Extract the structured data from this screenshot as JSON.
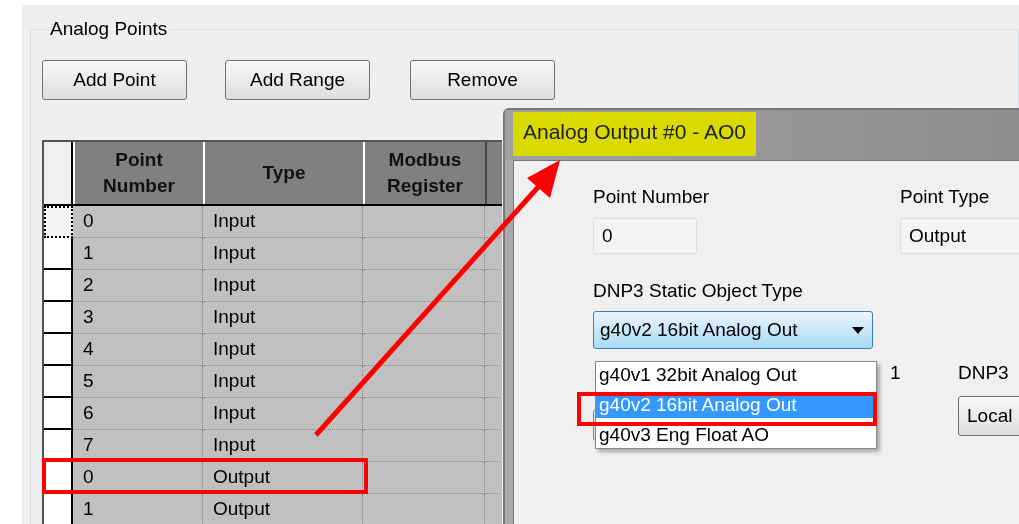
{
  "group_title": "Analog Points",
  "buttons": [
    "Add Point",
    "Add Range",
    "Remove"
  ],
  "table": {
    "columns": [
      "Point Number",
      "Type",
      "Modbus Register"
    ],
    "rows": [
      {
        "cells": [
          "0",
          "Input"
        ],
        "focused": true,
        "highlighted": false
      },
      {
        "cells": [
          "1",
          "Input"
        ],
        "focused": false,
        "highlighted": false
      },
      {
        "cells": [
          "2",
          "Input"
        ],
        "focused": false,
        "highlighted": false
      },
      {
        "cells": [
          "3",
          "Input"
        ],
        "focused": false,
        "highlighted": false
      },
      {
        "cells": [
          "4",
          "Input"
        ],
        "focused": false,
        "highlighted": false
      },
      {
        "cells": [
          "5",
          "Input"
        ],
        "focused": false,
        "highlighted": false
      },
      {
        "cells": [
          "6",
          "Input"
        ],
        "focused": false,
        "highlighted": false
      },
      {
        "cells": [
          "7",
          "Input"
        ],
        "focused": false,
        "highlighted": false
      },
      {
        "cells": [
          "0",
          "Output"
        ],
        "focused": false,
        "highlighted": true
      },
      {
        "cells": [
          "1",
          "Output"
        ],
        "focused": false,
        "highlighted": false
      }
    ]
  },
  "dialog": {
    "title": "Analog Output #0 - AO0",
    "title_highlighted": true,
    "point_number": {
      "label": "Point Number",
      "value": "0"
    },
    "point_type": {
      "label": "Point Type",
      "value": "Output"
    },
    "static_type": {
      "label": "DNP3 Static Object Type",
      "value": "g40v2 16bit Analog Out",
      "options": [
        {
          "label": "g40v1 32bit Analog Out",
          "selected": false,
          "highlighted": false
        },
        {
          "label": "g40v2 16bit Analog Out",
          "selected": true,
          "highlighted": true
        },
        {
          "label": "g40v3 Eng Float AO",
          "selected": false,
          "highlighted": false
        }
      ]
    },
    "partial_label": "1",
    "dnp3_label": "DNP3",
    "local_button": "Local"
  }
}
